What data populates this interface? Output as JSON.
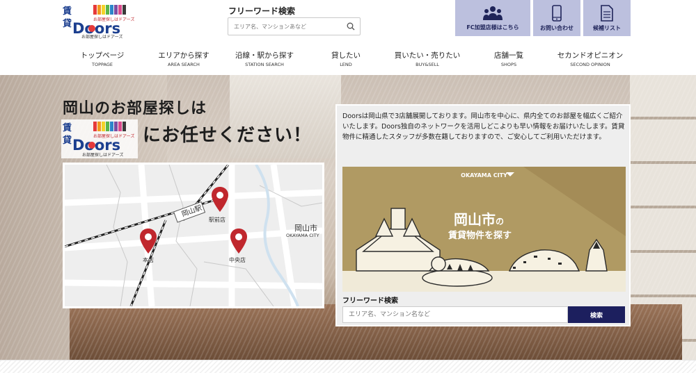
{
  "header": {
    "logo_sub": "お部屋探しはドアーズ",
    "free_word_title": "フリーワード検索",
    "free_word_placeholder": "エリア名、マンションあなど",
    "buttons": [
      {
        "label": "FC加盟店様はこちら",
        "icon": "people-icon"
      },
      {
        "label": "お問い合わせ",
        "icon": "phone-icon"
      },
      {
        "label": "候補リスト",
        "icon": "document-icon"
      }
    ]
  },
  "nav": [
    {
      "jp": "トップページ",
      "en": "TOPPAGE"
    },
    {
      "jp": "エリアから探す",
      "en": "AREA SEARCH"
    },
    {
      "jp": "沿線・駅から探す",
      "en": "STATION SEARCH"
    },
    {
      "jp": "貸したい",
      "en": "LEND"
    },
    {
      "jp": "買いたい・売りたい",
      "en": "BUY&SELL"
    },
    {
      "jp": "店舗一覧",
      "en": "SHOPS"
    },
    {
      "jp": "セカンドオピニオン",
      "en": "SECOND OPINION"
    }
  ],
  "hero": {
    "title_line1": "岡山のお部屋探しは",
    "title_line2": "にお任せください！",
    "logo_sub": "お部屋探しはドアーズ"
  },
  "map": {
    "station": "岡山駅",
    "city_jp": "岡山市",
    "city_en": "OKAYAMA CITY",
    "pins": [
      "駅前店",
      "本店",
      "中央店"
    ]
  },
  "panel": {
    "description": "Doorsは岡山県で3店舗展開しております。岡山市を中心に、県内全てのお部屋を幅広くご紹介いたします。Doors独自のネットワークを活用しどこよりも早い情報をお届けいたします。賃貸物件に精通したスタッフが多数在籍しておりますので、ご安心してご利用いただけます。",
    "city_tag": "OKAYAMA CITY",
    "city_title": "岡山市",
    "city_title_suffix": "の",
    "city_subtitle": "賃貸物件を探す",
    "free_word_title": "フリーワード検索",
    "free_word_placeholder": "エリア名、マンション名など",
    "search_button": "検索"
  },
  "colors": {
    "header_button": "#bcc0de",
    "navy": "#1c1f5e",
    "city_bg": "#b09a63",
    "pin": "#c0272d"
  }
}
